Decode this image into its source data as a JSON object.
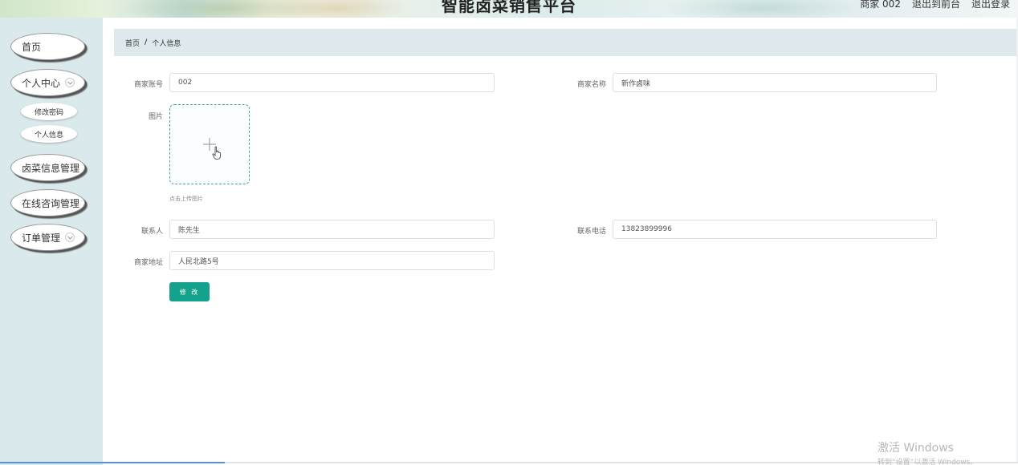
{
  "header": {
    "title": "智能卤菜销售平台",
    "merchant": "商家 002",
    "back_to_front": "退出到前台",
    "logout": "退出登录"
  },
  "sidebar": {
    "items": [
      {
        "label": "首页"
      },
      {
        "label": "个人中心",
        "expandable": true
      },
      {
        "label": "卤菜信息管理"
      },
      {
        "label": "在线咨询管理"
      },
      {
        "label": "订单管理",
        "expandable": true
      }
    ],
    "sub_items": [
      {
        "label": "修改密码"
      },
      {
        "label": "个人信息"
      }
    ]
  },
  "breadcrumb": {
    "home": "首页",
    "separator": "/",
    "current": "个人信息"
  },
  "form": {
    "account_label": "商家账号",
    "account_value": "002",
    "name_label": "商家名称",
    "name_value": "新作卤味",
    "image_label": "图片",
    "upload_hint": "点击上传图片",
    "contact_label": "联系人",
    "contact_value": "陈先生",
    "phone_label": "联系电话",
    "phone_value": "13823899996",
    "address_label": "商家地址",
    "address_value": "人民北路5号",
    "submit_label": "修 改"
  },
  "watermark": {
    "line1": "激活 Windows",
    "line2": "转到“设置”以激活 Windows。"
  },
  "colors": {
    "accent": "#15a28c",
    "sidebar_bg": "#d9e9ec",
    "breadcrumb_bg": "#dde9ec",
    "upload_border": "#3fa5a0"
  },
  "icons": [
    "plus-icon",
    "hand-pointer-icon",
    "chevron-down-icon"
  ]
}
